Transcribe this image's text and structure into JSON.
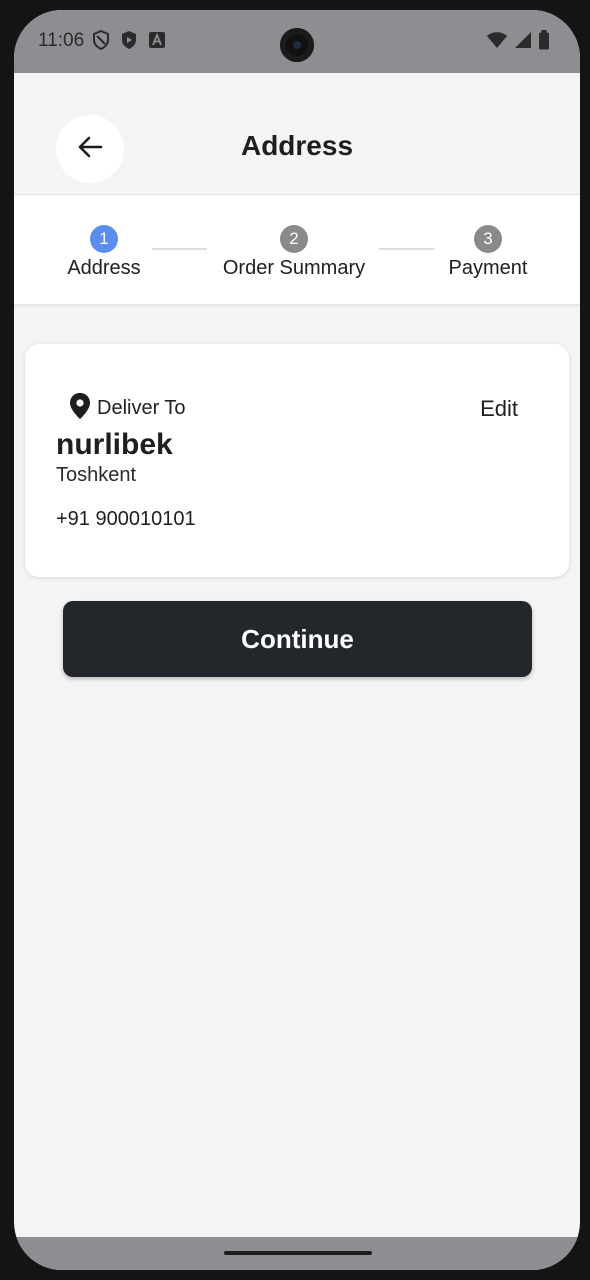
{
  "status_bar": {
    "time": "11:06",
    "left_icons": [
      "shield-icon",
      "play-protect-icon",
      "a-icon"
    ],
    "right_icons": [
      "wifi-icon",
      "signal-icon",
      "battery-icon"
    ]
  },
  "header": {
    "title": "Address",
    "back_icon": "arrow-left-icon"
  },
  "stepper": {
    "steps": [
      {
        "number": "1",
        "label": "Address",
        "active": true
      },
      {
        "number": "2",
        "label": "Order Summary",
        "active": false
      },
      {
        "number": "3",
        "label": "Payment",
        "active": false
      }
    ],
    "colors": {
      "active": "#5b8def",
      "inactive": "#8a8a8a"
    }
  },
  "address_card": {
    "deliver_label": "Deliver To",
    "location_icon": "location-pin-icon",
    "edit_label": "Edit",
    "name": "nurlibek",
    "city": "Toshkent",
    "phone": "+91 900010101"
  },
  "continue_button": {
    "label": "Continue",
    "color": "#23272b"
  }
}
